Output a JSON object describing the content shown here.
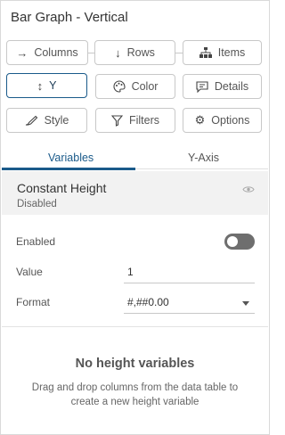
{
  "title": "Bar Graph - Vertical",
  "buttons": {
    "columns": "Columns",
    "rows": "Rows",
    "items": "Items",
    "y": "Y",
    "color": "Color",
    "details": "Details",
    "style": "Style",
    "filters": "Filters",
    "options": "Options"
  },
  "tabs": {
    "variables": "Variables",
    "yaxis": "Y-Axis"
  },
  "variable": {
    "name": "Constant Height",
    "status": "Disabled"
  },
  "form": {
    "enabled_label": "Enabled",
    "value_label": "Value",
    "value": "1",
    "format_label": "Format",
    "format_value": "#,##0.00"
  },
  "empty": {
    "title": "No height variables",
    "description": "Drag and drop columns from the data table to create a new height variable"
  },
  "colors": {
    "accent": "#1a5a8a",
    "toggle_off": "#6e6e6e"
  }
}
